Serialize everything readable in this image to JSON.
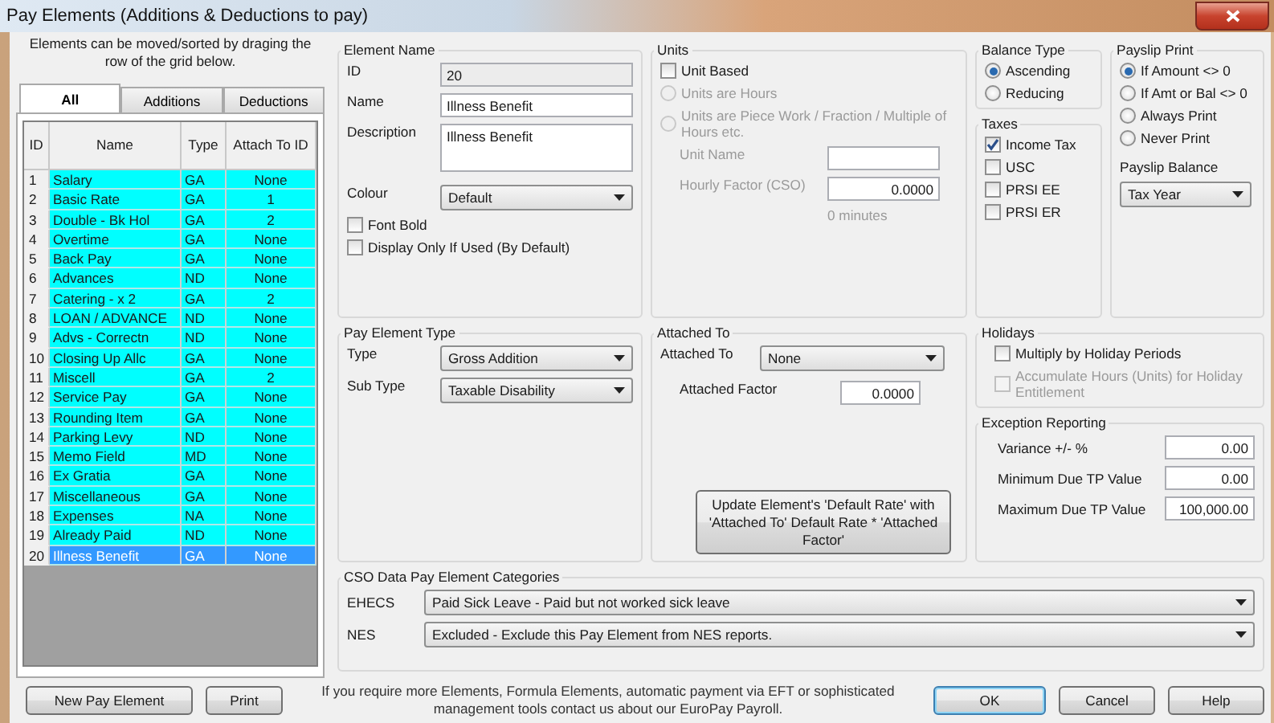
{
  "window": {
    "title": "Pay Elements (Additions & Deductions to pay)"
  },
  "elements_panel": {
    "hint": "Elements can be moved/sorted by draging the row of the grid below.",
    "tabs": [
      {
        "label": "All",
        "selected": true
      },
      {
        "label": "Additions",
        "selected": false
      },
      {
        "label": "Deductions",
        "selected": false
      }
    ],
    "columns": [
      "ID",
      "Name",
      "Type",
      "Attach To ID"
    ],
    "rows": [
      {
        "id": "1",
        "name": "Salary",
        "type": "GA",
        "attach_to_id": "None",
        "selected": false
      },
      {
        "id": "2",
        "name": "Basic Rate",
        "type": "GA",
        "attach_to_id": "1",
        "selected": false
      },
      {
        "id": "3",
        "name": "Double - Bk Hol",
        "type": "GA",
        "attach_to_id": "2",
        "selected": false
      },
      {
        "id": "4",
        "name": "Overtime",
        "type": "GA",
        "attach_to_id": "None",
        "selected": false
      },
      {
        "id": "5",
        "name": "Back Pay",
        "type": "GA",
        "attach_to_id": "None",
        "selected": false
      },
      {
        "id": "6",
        "name": "Advances",
        "type": "ND",
        "attach_to_id": "None",
        "selected": false
      },
      {
        "id": "7",
        "name": "Catering - x 2",
        "type": "GA",
        "attach_to_id": "2",
        "selected": false
      },
      {
        "id": "8",
        "name": "LOAN / ADVANCE",
        "type": "ND",
        "attach_to_id": "None",
        "selected": false
      },
      {
        "id": "9",
        "name": "Advs - Correctn",
        "type": "ND",
        "attach_to_id": "None",
        "selected": false
      },
      {
        "id": "10",
        "name": "Closing Up Allc",
        "type": "GA",
        "attach_to_id": "None",
        "selected": false
      },
      {
        "id": "11",
        "name": "Miscell",
        "type": "GA",
        "attach_to_id": "2",
        "selected": false
      },
      {
        "id": "12",
        "name": "Service Pay",
        "type": "GA",
        "attach_to_id": "None",
        "selected": false
      },
      {
        "id": "13",
        "name": "Rounding Item",
        "type": "GA",
        "attach_to_id": "None",
        "selected": false
      },
      {
        "id": "14",
        "name": "Parking Levy",
        "type": "ND",
        "attach_to_id": "None",
        "selected": false
      },
      {
        "id": "15",
        "name": "Memo Field",
        "type": "MD",
        "attach_to_id": "None",
        "selected": false
      },
      {
        "id": "16",
        "name": "Ex Gratia",
        "type": "GA",
        "attach_to_id": "None",
        "selected": false
      },
      {
        "id": "17",
        "name": "Miscellaneous",
        "type": "GA",
        "attach_to_id": "None",
        "selected": false
      },
      {
        "id": "18",
        "name": "Expenses",
        "type": "NA",
        "attach_to_id": "None",
        "selected": false
      },
      {
        "id": "19",
        "name": "Already Paid",
        "type": "ND",
        "attach_to_id": "None",
        "selected": false
      },
      {
        "id": "20",
        "name": "Illness Benefit",
        "type": "GA",
        "attach_to_id": "None",
        "selected": true
      }
    ]
  },
  "element_name": {
    "title": "Element Name",
    "id": {
      "label": "ID",
      "value": "20",
      "disabled": true
    },
    "name": {
      "label": "Name",
      "value": "Illness Benefit"
    },
    "description": {
      "label": "Description",
      "value": "Illness Benefit"
    },
    "colour": {
      "label": "Colour",
      "value": "Default"
    },
    "checkboxes": [
      {
        "label": "Font Bold",
        "checked": false
      },
      {
        "label": "Display Only If Used (By Default)",
        "checked": false
      }
    ]
  },
  "units": {
    "title": "Units",
    "unit_based": {
      "label": "Unit Based",
      "checked": false
    },
    "options": [
      {
        "label": "Units are Hours",
        "selected": false,
        "disabled": true
      },
      {
        "label": "Units are Piece Work / Fraction / Multiple of Hours etc.",
        "selected": false,
        "disabled": true
      }
    ],
    "unit_name": {
      "label": "Unit Name",
      "disabled": true
    },
    "hourly_factor": {
      "label": "Hourly Factor (CSO)",
      "value": "0.0000",
      "disabled": true
    },
    "minutes": "0 minutes"
  },
  "balance_type": {
    "title": "Balance Type",
    "options": [
      {
        "label": "Ascending",
        "selected": true
      },
      {
        "label": "Reducing",
        "selected": false
      }
    ]
  },
  "taxes": {
    "title": "Taxes",
    "items": [
      {
        "label": "Income Tax",
        "checked": true
      },
      {
        "label": "USC",
        "checked": false
      },
      {
        "label": "PRSI EE",
        "checked": false
      },
      {
        "label": "PRSI ER",
        "checked": false
      }
    ]
  },
  "payslip_print": {
    "title": "Payslip Print",
    "options": [
      {
        "label": "If Amount <> 0",
        "selected": true
      },
      {
        "label": "If Amt or Bal <> 0",
        "selected": false
      },
      {
        "label": "Always Print",
        "selected": false
      },
      {
        "label": "Never Print",
        "selected": false
      }
    ],
    "balance_label": "Payslip Balance",
    "balance_value": "Tax Year"
  },
  "pay_element_type": {
    "title": "Pay Element Type",
    "fields": [
      {
        "label": "Type",
        "value": "Gross Addition"
      },
      {
        "label": "Sub Type",
        "value": "Taxable Disability"
      }
    ]
  },
  "attached_to": {
    "title": "Attached To",
    "attached_to": {
      "label": "Attached To",
      "value": "None"
    },
    "attached_factor": {
      "label": "Attached Factor",
      "value": "0.0000"
    },
    "update_button": "Update Element's 'Default Rate' with 'Attached To' Default Rate * 'Attached Factor'"
  },
  "holidays": {
    "title": "Holidays",
    "items": [
      {
        "label": "Multiply by Holiday Periods",
        "checked": false,
        "disabled": false
      },
      {
        "label": "Accumulate Hours (Units) for Holiday Entitlement",
        "checked": false,
        "disabled": true
      }
    ]
  },
  "exception_reporting": {
    "title": "Exception Reporting",
    "fields": [
      {
        "label": "Variance +/- %",
        "value": "0.00"
      },
      {
        "label": "Minimum Due TP Value",
        "value": "0.00"
      },
      {
        "label": "Maximum Due TP Value",
        "value": "100,000.00"
      }
    ]
  },
  "cso": {
    "title": "CSO Data Pay Element Categories",
    "fields": [
      {
        "label": "EHECS",
        "value": "Paid Sick Leave - Paid but not worked sick leave"
      },
      {
        "label": "NES",
        "value": "Excluded - Exclude this Pay Element from NES reports."
      }
    ]
  },
  "footer": {
    "buttons_left": [
      "New Pay Element",
      "Print"
    ],
    "note": "If you require more Elements, Formula Elements, automatic payment via EFT or sophisticated management tools contact us about our EuroPay Payroll.",
    "buttons_right": [
      {
        "label": "OK",
        "default": true
      },
      {
        "label": "Cancel",
        "default": false
      },
      {
        "label": "Help",
        "default": false
      }
    ]
  }
}
